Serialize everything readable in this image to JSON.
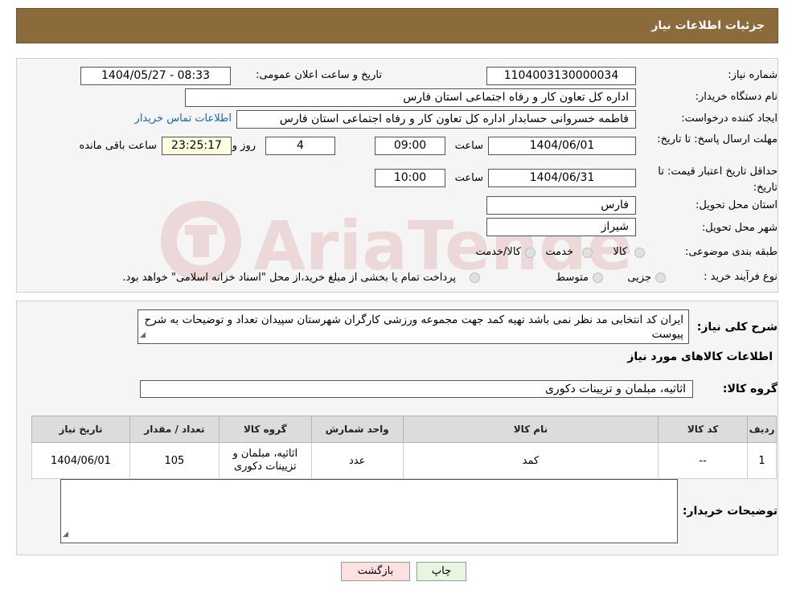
{
  "header": {
    "title": "جزئیات اطلاعات نیاز"
  },
  "form": {
    "need_number_label": "شماره نیاز:",
    "need_number_value": "1104003130000034",
    "announce_label": "تاریخ و ساعت اعلان عمومی:",
    "announce_value": "1404/05/27 - 08:33",
    "buyer_org_label": "نام دستگاه خریدار:",
    "buyer_org_value": "اداره کل تعاون  کار و رفاه اجتماعی استان فارس",
    "creator_label": "ایجاد کننده درخواست:",
    "creator_value": "فاطمه خسروانی حسابدار اداره کل تعاون  کار و رفاه اجتماعی استان فارس",
    "contact_link": "اطلاعات تماس خریدار",
    "deadline_label": "مهلت ارسال پاسخ: تا تاریخ:",
    "deadline_date": "1404/06/01",
    "time_label": "ساعت",
    "deadline_time": "09:00",
    "days_value": "4",
    "days_label": "روز و",
    "remaining_time": "23:25:17",
    "remaining_label": "ساعت باقی مانده",
    "validity_label": "حداقل تاریخ اعتبار قیمت: تا تاریخ:",
    "validity_date": "1404/06/31",
    "validity_time": "10:00",
    "province_label": "استان محل تحویل:",
    "province_value": "فارس",
    "city_label": "شهر محل تحویل:",
    "city_value": "شیراز",
    "category_label": "طبقه بندی موضوعی:",
    "category_options": [
      "کالا",
      "خدمت",
      "کالا/خدمت"
    ],
    "process_label": "نوع فرآیند خرید :",
    "process_options": [
      "جزیی",
      "متوسط"
    ],
    "process_note": "پرداخت تمام یا بخشی از مبلغ خرید،از محل \"اسناد خزانه اسلامی\" خواهد بود."
  },
  "description": {
    "label": "شرح کلی نیاز:",
    "text": "ایران کد انتخابی مد نظر نمی باشد تهیه کمد جهت مجموعه ورزشی کارگران شهرستان سپیدان تعداد و توضیحات به شرح پیوست"
  },
  "goods": {
    "section_title": "اطلاعات کالاهای مورد نیاز",
    "group_label": "گروه کالا:",
    "group_value": "اثاثیه، مبلمان و تزیینات دکوری",
    "columns": [
      "ردیف",
      "کد کالا",
      "نام کالا",
      "واحد شمارش",
      "گروه کالا",
      "تعداد / مقدار",
      "تاریخ نیاز"
    ],
    "rows": [
      [
        "1",
        "--",
        "کمد",
        "عدد",
        "اثاثیه، مبلمان و تزیینات دکوری",
        "105",
        "1404/06/01"
      ]
    ]
  },
  "buyer_notes": {
    "label": "توضیحات خریدار:",
    "text": ""
  },
  "buttons": {
    "print": "چاپ",
    "back": "بازگشت"
  },
  "watermark": {
    "text": "AriaTender.neT"
  }
}
